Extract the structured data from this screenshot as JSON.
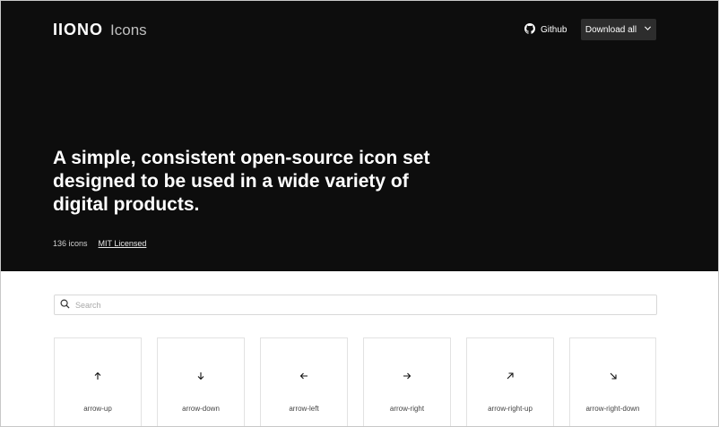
{
  "brand": {
    "logo": "IIONO",
    "name": "Icons"
  },
  "nav": {
    "github_label": "Github",
    "download_label": "Download all"
  },
  "hero": {
    "headline": "A simple, consistent open-source icon set designed to be used in a wide variety of digital products.",
    "icon_count": "136 icons",
    "license": "MIT Licensed"
  },
  "search": {
    "placeholder": "Search",
    "value": ""
  },
  "icons": [
    {
      "name": "arrow-up",
      "icon": "arrow-up-icon"
    },
    {
      "name": "arrow-down",
      "icon": "arrow-down-icon"
    },
    {
      "name": "arrow-left",
      "icon": "arrow-left-icon"
    },
    {
      "name": "arrow-right",
      "icon": "arrow-right-icon"
    },
    {
      "name": "arrow-right-up",
      "icon": "arrow-right-up-icon"
    },
    {
      "name": "arrow-right-down",
      "icon": "arrow-right-down-icon"
    }
  ],
  "colors": {
    "hero_bg": "#0d0d0d",
    "button_bg": "#2d2d2d",
    "card_border": "#e2e2e2"
  }
}
